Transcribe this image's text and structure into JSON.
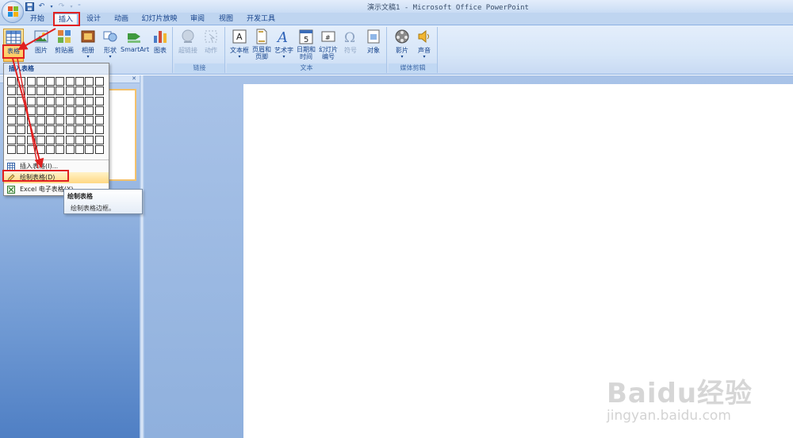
{
  "window": {
    "title": "演示文稿1 - Microsoft Office PowerPoint"
  },
  "tabs": [
    {
      "label": "开始"
    },
    {
      "label": "插入"
    },
    {
      "label": "设计"
    },
    {
      "label": "动画"
    },
    {
      "label": "幻灯片放映"
    },
    {
      "label": "审阅"
    },
    {
      "label": "视图"
    },
    {
      "label": "开发工具"
    }
  ],
  "ribbon": {
    "table": {
      "label": "表格"
    },
    "picture": {
      "label": "图片"
    },
    "clipart": {
      "label": "剪贴画"
    },
    "album": {
      "label": "相册"
    },
    "shapes": {
      "label": "形状"
    },
    "smartart": {
      "label": "SmartArt"
    },
    "chart": {
      "label": "图表"
    },
    "hyperlink": {
      "label": "超链接"
    },
    "action": {
      "label": "动作"
    },
    "textbox": {
      "label": "文本框"
    },
    "headerfooter": {
      "label1": "页眉和",
      "label2": "页脚"
    },
    "wordart": {
      "label": "艺术字"
    },
    "datetime": {
      "label1": "日期和",
      "label2": "时间"
    },
    "slidenum": {
      "label1": "幻灯片",
      "label2": "编号"
    },
    "symbol": {
      "label": "符号"
    },
    "object": {
      "label": "对象"
    },
    "movie": {
      "label": "影片"
    },
    "sound": {
      "label": "声音"
    },
    "groups": {
      "links": "链接",
      "text": "文本",
      "media": "媒体剪辑"
    }
  },
  "dropdown": {
    "header": "插入表格",
    "items": [
      {
        "label": "插入表格(I)..."
      },
      {
        "label": "绘制表格(D)"
      },
      {
        "label": "Excel 电子表格(X)"
      }
    ]
  },
  "tooltip": {
    "title": "绘制表格",
    "body": "绘制表格边框。"
  },
  "watermark": {
    "brand": "Baidu经验",
    "url": "jingyan.baidu.com"
  },
  "colors": {
    "annotation": "#e02020",
    "ribbon": "#d7e6f8",
    "pane": "#6f99d3"
  }
}
